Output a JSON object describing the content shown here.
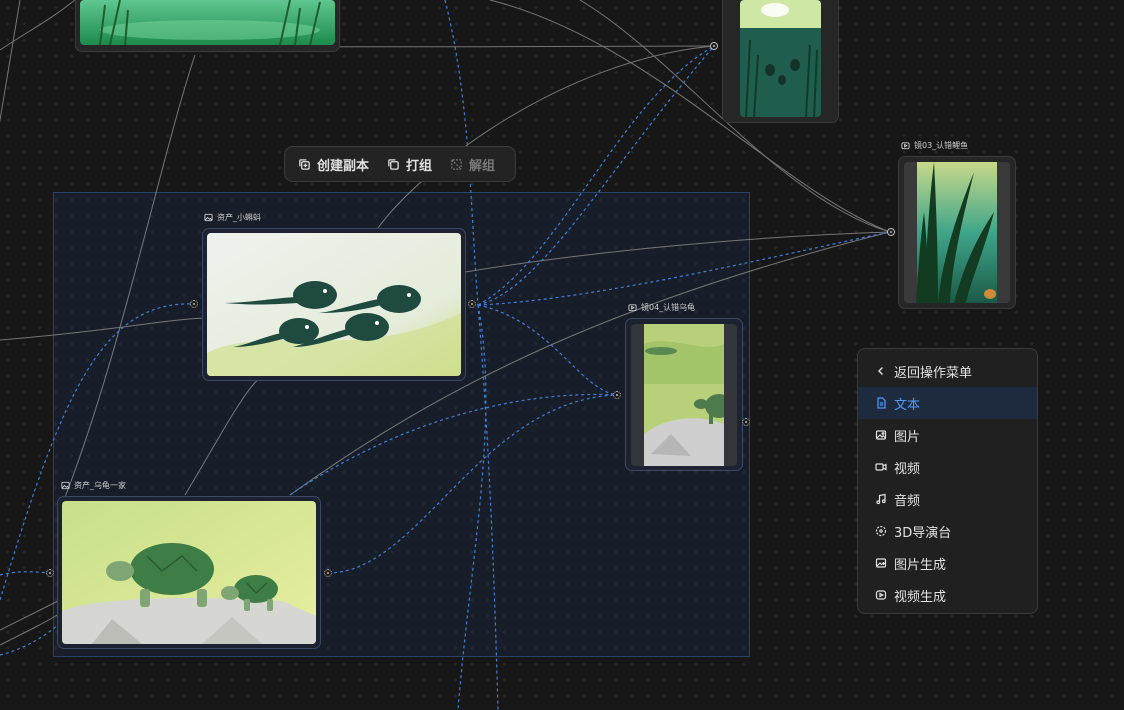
{
  "toolbar": {
    "duplicate_label": "创建副本",
    "group_label": "打组",
    "ungroup_label": "解组"
  },
  "nodes": {
    "tadpole": {
      "title": "资产_小蝌蚪"
    },
    "turtle_family": {
      "title": "资产_乌龟一家"
    },
    "shot04": {
      "title": "镜04_认错乌龟"
    },
    "shot03": {
      "title": "镜03_认错鲤鱼"
    }
  },
  "menu": {
    "back_label": "返回操作菜单",
    "items": [
      {
        "label": "文本",
        "icon": "document-icon",
        "active": true
      },
      {
        "label": "图片",
        "icon": "image-icon"
      },
      {
        "label": "视频",
        "icon": "video-icon"
      },
      {
        "label": "音频",
        "icon": "music-icon"
      },
      {
        "label": "3D导演台",
        "icon": "3d-stage-icon"
      },
      {
        "label": "图片生成",
        "icon": "image-generate-icon"
      },
      {
        "label": "视频生成",
        "icon": "video-generate-icon"
      }
    ]
  },
  "colors": {
    "accent": "#4f9bff",
    "canvas": "#171717",
    "selection": "#223c6e",
    "wire_solid": "#9a9a9a",
    "wire_dashed": "#3f7fd6"
  }
}
